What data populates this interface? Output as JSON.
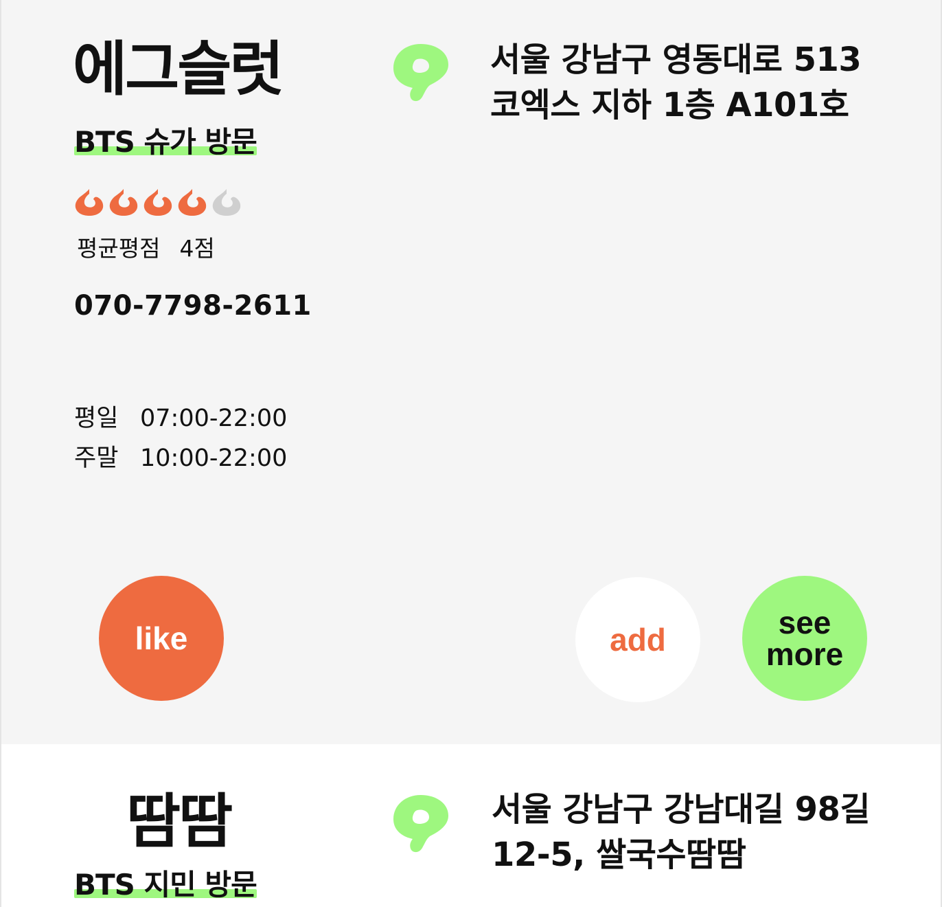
{
  "stores": [
    {
      "name": "에그슬럿",
      "tag": "BTS 슈가 방문",
      "rating_value": 4,
      "rating_max": 5,
      "rating_label": "평균평점",
      "rating_text": "4점",
      "phone": "070-7798-2611",
      "hours": [
        {
          "label": "평일",
          "time": "07:00-22:00"
        },
        {
          "label": "주말",
          "time": "10:00-22:00"
        }
      ],
      "address_line1": "서울 강남구 영동대로 513",
      "address_line2": "코엑스 지하 1층 A101호",
      "buttons": {
        "like": "like",
        "add": "add",
        "see": "see",
        "more": "more"
      }
    },
    {
      "name": "땀땀",
      "tag": "BTS 지민 방문",
      "address_line1": "서울 강남구 강남대길 98길",
      "address_line2": "12-5, 쌀국수땀땀"
    }
  ],
  "colors": {
    "accent_orange": "#ee6b40",
    "accent_green": "#9ef77f",
    "inactive_gray": "#cfcfcf",
    "card_bg": "#f5f5f5"
  },
  "icons": {
    "rating": "rating-drop-icon",
    "location": "location-pin-icon"
  }
}
